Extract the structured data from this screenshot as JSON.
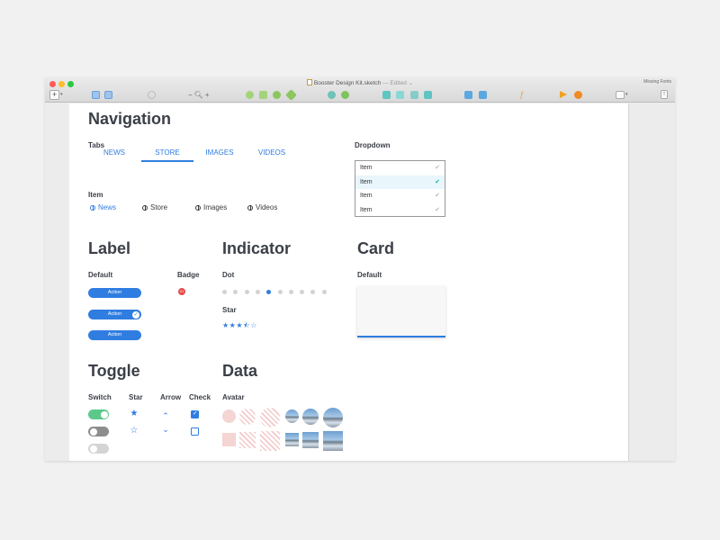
{
  "window": {
    "title": "Booster Design Kit.sketch",
    "edited": "— Edited ⌄",
    "missing_fonts": "Missing Fonts"
  },
  "toolbar": {
    "zoom_minus": "−",
    "zoom_plus": "+"
  },
  "navigation": {
    "title": "Navigation",
    "tabs_label": "Tabs",
    "tabs": [
      "NEWS",
      "STORE",
      "IMAGES",
      "VIDEOS"
    ],
    "active_tab": "STORE",
    "item_label": "Item",
    "items": [
      "News",
      "Store",
      "Images",
      "Videos"
    ],
    "active_item": "News",
    "dropdown_label": "Dropdown",
    "dropdown_items": [
      "Item",
      "Item",
      "Item",
      "Item"
    ],
    "dropdown_selected_index": 1
  },
  "label": {
    "title": "Label",
    "default_label": "Default",
    "badge_label": "Badge",
    "pills": [
      "Action",
      "Action",
      "Action"
    ],
    "badge_value": "01"
  },
  "indicator": {
    "title": "Indicator",
    "dot_label": "Dot",
    "dot_count": 10,
    "active_dot_index": 4,
    "star_label": "Star",
    "stars": "★★★⯪☆",
    "rating": 3.5
  },
  "card": {
    "title": "Card",
    "default_label": "Default"
  },
  "toggle": {
    "title": "Toggle",
    "columns": [
      "Switch",
      "Star",
      "Arrow",
      "Check"
    ],
    "star_filled": "★",
    "star_outline": "☆",
    "arrow_up": "⌃",
    "arrow_down": "⌄"
  },
  "data": {
    "title": "Data",
    "avatar_label": "Avatar"
  },
  "colors": {
    "accent": "#2f7de1",
    "switch_on": "#5cc98a",
    "badge": "#e54b4b",
    "selected_row": "#e9f6fb"
  }
}
